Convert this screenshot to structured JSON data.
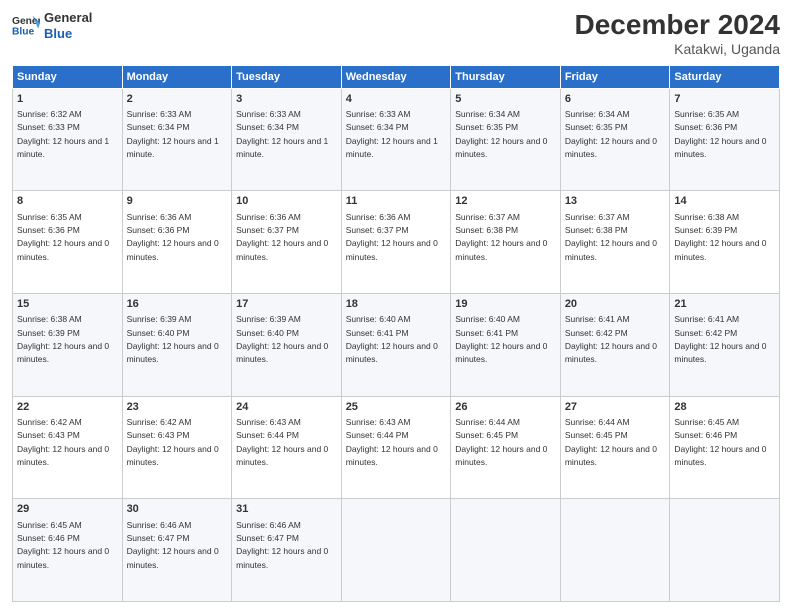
{
  "logo": {
    "line1": "General",
    "line2": "Blue"
  },
  "title": "December 2024",
  "subtitle": "Katakwi, Uganda",
  "days_header": [
    "Sunday",
    "Monday",
    "Tuesday",
    "Wednesday",
    "Thursday",
    "Friday",
    "Saturday"
  ],
  "weeks": [
    [
      {
        "day": "1",
        "sunrise": "6:32 AM",
        "sunset": "6:33 PM",
        "daylight": "12 hours and 1 minute."
      },
      {
        "day": "2",
        "sunrise": "6:33 AM",
        "sunset": "6:34 PM",
        "daylight": "12 hours and 1 minute."
      },
      {
        "day": "3",
        "sunrise": "6:33 AM",
        "sunset": "6:34 PM",
        "daylight": "12 hours and 1 minute."
      },
      {
        "day": "4",
        "sunrise": "6:33 AM",
        "sunset": "6:34 PM",
        "daylight": "12 hours and 1 minute."
      },
      {
        "day": "5",
        "sunrise": "6:34 AM",
        "sunset": "6:35 PM",
        "daylight": "12 hours and 0 minutes."
      },
      {
        "day": "6",
        "sunrise": "6:34 AM",
        "sunset": "6:35 PM",
        "daylight": "12 hours and 0 minutes."
      },
      {
        "day": "7",
        "sunrise": "6:35 AM",
        "sunset": "6:36 PM",
        "daylight": "12 hours and 0 minutes."
      }
    ],
    [
      {
        "day": "8",
        "sunrise": "6:35 AM",
        "sunset": "6:36 PM",
        "daylight": "12 hours and 0 minutes."
      },
      {
        "day": "9",
        "sunrise": "6:36 AM",
        "sunset": "6:36 PM",
        "daylight": "12 hours and 0 minutes."
      },
      {
        "day": "10",
        "sunrise": "6:36 AM",
        "sunset": "6:37 PM",
        "daylight": "12 hours and 0 minutes."
      },
      {
        "day": "11",
        "sunrise": "6:36 AM",
        "sunset": "6:37 PM",
        "daylight": "12 hours and 0 minutes."
      },
      {
        "day": "12",
        "sunrise": "6:37 AM",
        "sunset": "6:38 PM",
        "daylight": "12 hours and 0 minutes."
      },
      {
        "day": "13",
        "sunrise": "6:37 AM",
        "sunset": "6:38 PM",
        "daylight": "12 hours and 0 minutes."
      },
      {
        "day": "14",
        "sunrise": "6:38 AM",
        "sunset": "6:39 PM",
        "daylight": "12 hours and 0 minutes."
      }
    ],
    [
      {
        "day": "15",
        "sunrise": "6:38 AM",
        "sunset": "6:39 PM",
        "daylight": "12 hours and 0 minutes."
      },
      {
        "day": "16",
        "sunrise": "6:39 AM",
        "sunset": "6:40 PM",
        "daylight": "12 hours and 0 minutes."
      },
      {
        "day": "17",
        "sunrise": "6:39 AM",
        "sunset": "6:40 PM",
        "daylight": "12 hours and 0 minutes."
      },
      {
        "day": "18",
        "sunrise": "6:40 AM",
        "sunset": "6:41 PM",
        "daylight": "12 hours and 0 minutes."
      },
      {
        "day": "19",
        "sunrise": "6:40 AM",
        "sunset": "6:41 PM",
        "daylight": "12 hours and 0 minutes."
      },
      {
        "day": "20",
        "sunrise": "6:41 AM",
        "sunset": "6:42 PM",
        "daylight": "12 hours and 0 minutes."
      },
      {
        "day": "21",
        "sunrise": "6:41 AM",
        "sunset": "6:42 PM",
        "daylight": "12 hours and 0 minutes."
      }
    ],
    [
      {
        "day": "22",
        "sunrise": "6:42 AM",
        "sunset": "6:43 PM",
        "daylight": "12 hours and 0 minutes."
      },
      {
        "day": "23",
        "sunrise": "6:42 AM",
        "sunset": "6:43 PM",
        "daylight": "12 hours and 0 minutes."
      },
      {
        "day": "24",
        "sunrise": "6:43 AM",
        "sunset": "6:44 PM",
        "daylight": "12 hours and 0 minutes."
      },
      {
        "day": "25",
        "sunrise": "6:43 AM",
        "sunset": "6:44 PM",
        "daylight": "12 hours and 0 minutes."
      },
      {
        "day": "26",
        "sunrise": "6:44 AM",
        "sunset": "6:45 PM",
        "daylight": "12 hours and 0 minutes."
      },
      {
        "day": "27",
        "sunrise": "6:44 AM",
        "sunset": "6:45 PM",
        "daylight": "12 hours and 0 minutes."
      },
      {
        "day": "28",
        "sunrise": "6:45 AM",
        "sunset": "6:46 PM",
        "daylight": "12 hours and 0 minutes."
      }
    ],
    [
      {
        "day": "29",
        "sunrise": "6:45 AM",
        "sunset": "6:46 PM",
        "daylight": "12 hours and 0 minutes."
      },
      {
        "day": "30",
        "sunrise": "6:46 AM",
        "sunset": "6:47 PM",
        "daylight": "12 hours and 0 minutes."
      },
      {
        "day": "31",
        "sunrise": "6:46 AM",
        "sunset": "6:47 PM",
        "daylight": "12 hours and 0 minutes."
      },
      null,
      null,
      null,
      null
    ]
  ]
}
